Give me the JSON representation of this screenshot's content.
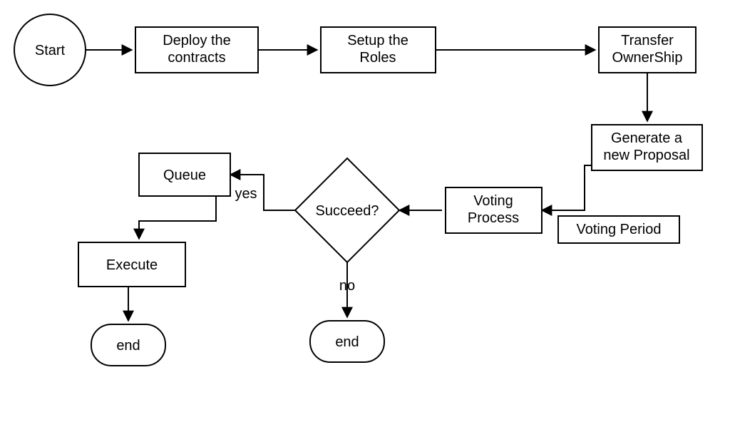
{
  "nodes": {
    "start": "Start",
    "deploy": "Deploy the\ncontracts",
    "roles": "Setup the\nRoles",
    "transfer": "Transfer\nOwnerShip",
    "proposal": "Generate a\nnew Proposal",
    "voting": "Voting\nProcess",
    "votingPeriod": "Voting Period",
    "succeed": "Succeed?",
    "queue": "Queue",
    "execute": "Execute",
    "end1": "end",
    "end2": "end"
  },
  "edges": {
    "yes": "yes",
    "no": "no"
  }
}
